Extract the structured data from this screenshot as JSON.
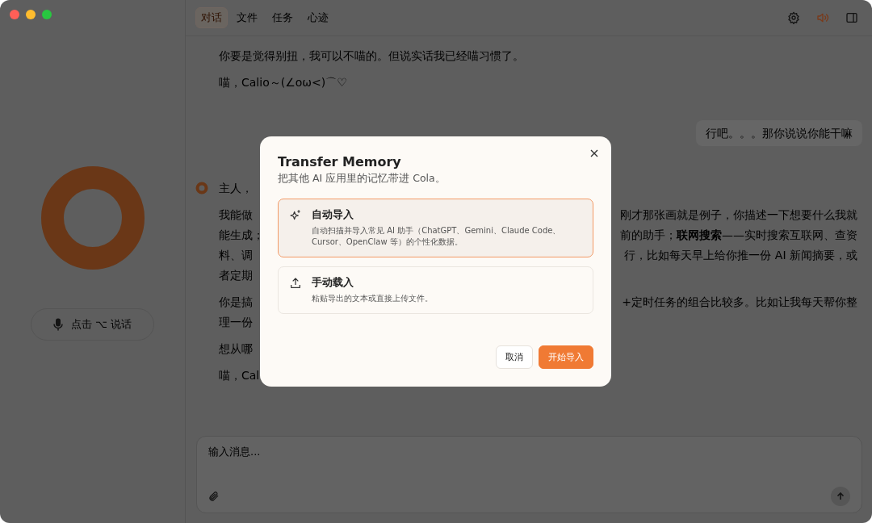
{
  "tabs": [
    {
      "label": "对话",
      "selected": true
    },
    {
      "label": "文件",
      "selected": false
    },
    {
      "label": "任务",
      "selected": false
    },
    {
      "label": "心迹",
      "selected": false
    }
  ],
  "sidebar": {
    "voice_button": "点击 ⌥ 说话"
  },
  "messages": [
    {
      "kind": "assistant",
      "avatar": false,
      "paragraphs": [
        [
          {
            "left": "你要是觉得别扭，我可以不喵的。但说实话我已经喵习惯了。"
          }
        ],
        [
          {
            "left": "喵，Calio～(∠oω<)⌒♡"
          }
        ]
      ]
    },
    {
      "kind": "user",
      "text": "行吧。。。那你说说你能干嘛"
    },
    {
      "kind": "assistant",
      "avatar": true,
      "paragraphs": [
        [
          {
            "left": "主人，"
          }
        ],
        [
          {
            "left": "我能做",
            "right": "刚才那张画就是例子，你描述一下想要什么我就"
          },
          {
            "left": "能生成；",
            "right": "前的助手；**联网搜索**——实时搜索互联网、查资"
          },
          {
            "left": "料、调",
            "right": "行，比如每天早上给你推一份 AI 新闻摘要，或"
          },
          {
            "left": "者定期"
          }
        ],
        [
          {
            "left": "你是搞",
            "right": "+定时任务的组合比较多。比如让我每天帮你整"
          },
          {
            "left": "理一份"
          }
        ],
        [
          {
            "left": "想从哪"
          }
        ],
        [
          {
            "left": "喵，Cal"
          }
        ]
      ]
    }
  ],
  "composer": {
    "placeholder": "输入消息..."
  },
  "dialog": {
    "title": "Transfer Memory",
    "subtitle": "把其他 AI 应用里的记忆带进 Cola。",
    "options": [
      {
        "kind": "auto",
        "title": "自动导入",
        "description": "自动扫描并导入常见 AI 助手（ChatGPT、Gemini、Claude Code、Cursor、OpenClaw 等）的个性化数据。",
        "selected": true
      },
      {
        "kind": "manual",
        "title": "手动载入",
        "description": "粘贴导出的文本或直接上传文件。",
        "selected": false
      }
    ],
    "buttons": [
      {
        "kind": "secondary",
        "label": "取消"
      },
      {
        "kind": "primary",
        "label": "开始导入"
      }
    ]
  }
}
